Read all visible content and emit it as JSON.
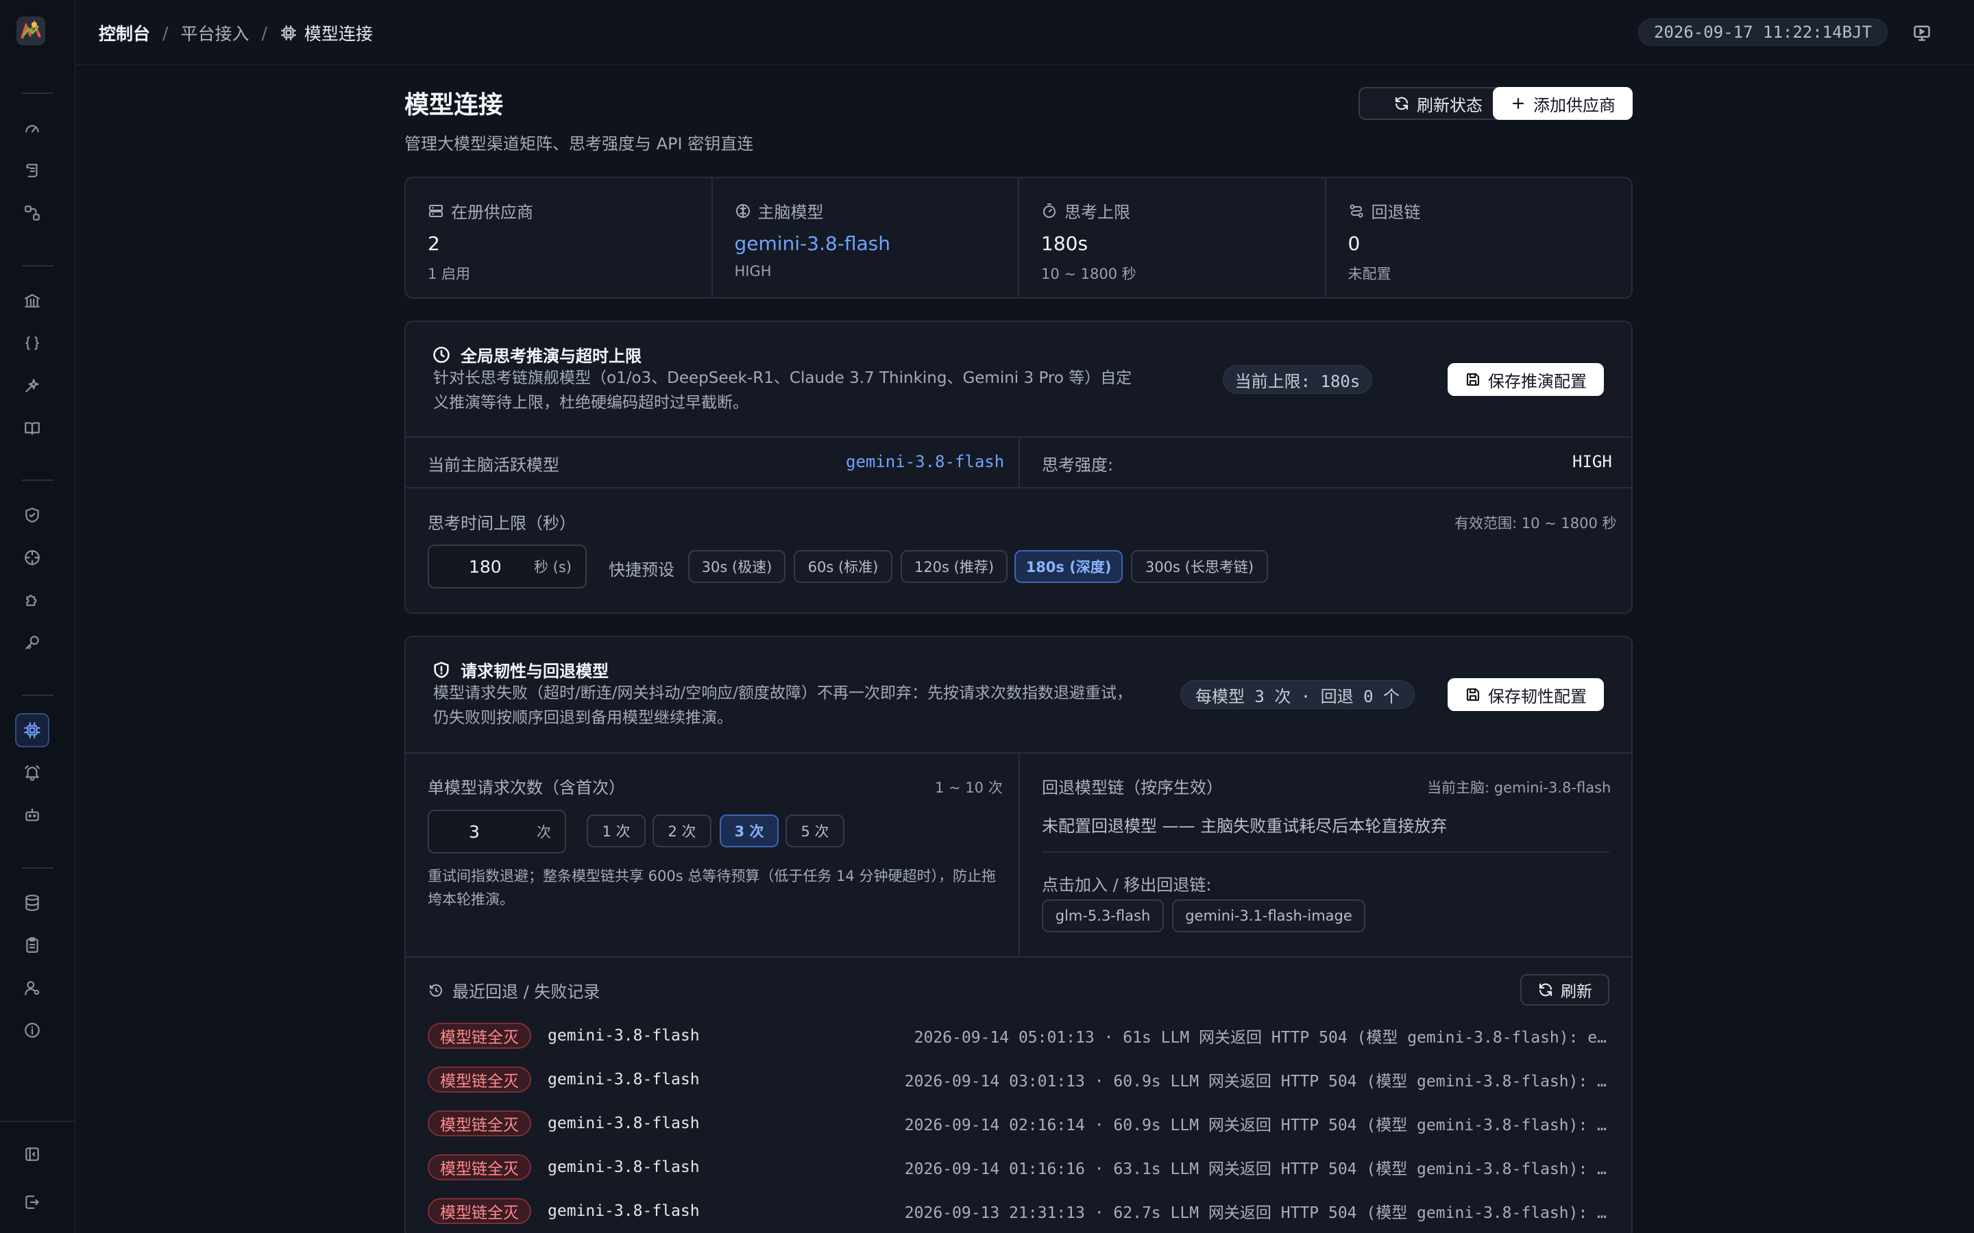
{
  "header": {
    "breadcrumb_root": "控制台",
    "breadcrumb_mid": "平台接入",
    "breadcrumb_current": "模型连接",
    "separator": "/",
    "clock": "2026-09-17 11:22:14BJT"
  },
  "page": {
    "title": "模型连接",
    "subtitle": "管理大模型渠道矩阵、思考强度与 API 密钥直连",
    "refresh_label": "刷新状态",
    "add_provider_label": "添加供应商"
  },
  "stats": [
    {
      "label": "在册供应商",
      "value": "2",
      "sub": "1 启用",
      "icon": "server-icon"
    },
    {
      "label": "主脑模型",
      "value": "gemini-3.8-flash",
      "sub": "HIGH",
      "icon": "brain-icon"
    },
    {
      "label": "思考上限",
      "value": "180s",
      "sub": "10 ~ 1800 秒",
      "icon": "timer-icon"
    },
    {
      "label": "回退链",
      "value": "0",
      "sub": "未配置",
      "icon": "route-icon"
    }
  ],
  "thinking": {
    "title": "全局思考推演与超时上限",
    "desc": "针对长思考链旗舰模型（o1/o3、DeepSeek-R1、Claude 3.7 Thinking、Gemini 3 Pro 等）自定义推演等待上限，杜绝硬编码超时过早截断。",
    "current_limit": "当前上限: 180s",
    "save_label": "保存推演配置",
    "active_model_label": "当前主脑活跃模型",
    "active_model_value": "gemini-3.8-flash",
    "strength_label": "思考强度:",
    "strength_value": "HIGH",
    "limit_label": "思考时间上限（秒）",
    "range_label": "有效范围: 10 ~ 1800 秒",
    "input_value": "180",
    "input_unit": "秒 (s)",
    "presets_label": "快捷预设",
    "presets": [
      "30s (极速)",
      "60s (标准)",
      "120s (推荐)",
      "180s (深度)",
      "300s (长思考链)"
    ],
    "active_preset": 3
  },
  "resilience": {
    "title": "请求韧性与回退模型",
    "desc": "模型请求失败（超时/断连/网关抖动/空响应/额度故障）不再一次即弃：先按请求次数指数退避重试，仍失败则按顺序回退到备用模型继续推演。",
    "summary": "每模型 3 次 · 回退 0 个",
    "save_label": "保存韧性配置",
    "retry_label": "单模型请求次数（含首次）",
    "retry_range": "1 ~ 10 次",
    "retry_value": "3",
    "retry_unit": "次",
    "retry_options": [
      "1 次",
      "2 次",
      "3 次",
      "5 次"
    ],
    "active_retry": 2,
    "retry_note": "重试间指数退避；整条模型链共享 600s 总等待预算（低于任务 14 分钟硬超时），防止拖垮本轮推演。",
    "chain_label": "回退模型链（按序生效）",
    "chain_current": "当前主脑: gemini-3.8-flash",
    "chain_empty": "未配置回退模型 —— 主脑失败重试耗尽后本轮直接放弃",
    "chain_add_label": "点击加入 / 移出回退链:",
    "chain_candidates": [
      "glm-5.3-flash",
      "gemini-3.1-flash-image"
    ]
  },
  "logs": {
    "title": "最近回退 / 失败记录",
    "refresh_label": "刷新",
    "rows": [
      {
        "badge": "模型链全灭",
        "model": "gemini-3.8-flash",
        "msg": "2026-09-14 05:01:13 · 61s  LLM 网关返回 HTTP 504 (模型 gemini-3.8-flash): e…"
      },
      {
        "badge": "模型链全灭",
        "model": "gemini-3.8-flash",
        "msg": "2026-09-14 03:01:13 · 60.9s  LLM 网关返回 HTTP 504 (模型 gemini-3.8-flash): …"
      },
      {
        "badge": "模型链全灭",
        "model": "gemini-3.8-flash",
        "msg": "2026-09-14 02:16:14 · 60.9s  LLM 网关返回 HTTP 504 (模型 gemini-3.8-flash): …"
      },
      {
        "badge": "模型链全灭",
        "model": "gemini-3.8-flash",
        "msg": "2026-09-14 01:16:16 · 63.1s  LLM 网关返回 HTTP 504 (模型 gemini-3.8-flash): …"
      },
      {
        "badge": "模型链全灭",
        "model": "gemini-3.8-flash",
        "msg": "2026-09-13 21:31:13 · 62.7s  LLM 网关返回 HTTP 504 (模型 gemini-3.8-flash): …"
      }
    ]
  },
  "colors": {
    "accent": "#6ea2ff",
    "danger": "#ff8a8f",
    "background": "#0f131c"
  }
}
